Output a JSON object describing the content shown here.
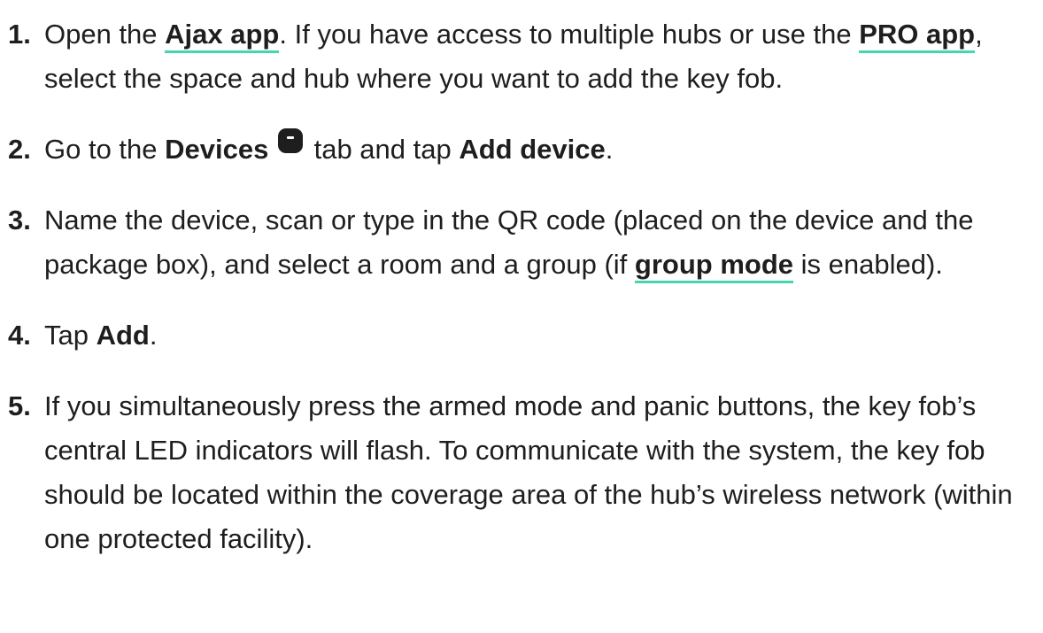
{
  "steps": [
    {
      "number": "1.",
      "t1": "Open the ",
      "link_ajax": "Ajax app",
      "t2": ". If you have access to multiple hubs or use the ",
      "link_pro": "PRO app",
      "t3": ", select the space and hub where you want to add the key fob."
    },
    {
      "number": "2.",
      "t1": "Go to the ",
      "devices_label": "Devices",
      "t2": " tab and tap ",
      "add_device_label": "Add device",
      "t3": "."
    },
    {
      "number": "3.",
      "t1": "Name the device, scan or type in the QR code (placed on the device and the package box), and select a room and a group (if ",
      "link_group_mode": "group mode",
      "t2": " is enabled)."
    },
    {
      "number": "4.",
      "t1": "Tap ",
      "add_label": "Add",
      "t2": "."
    },
    {
      "number": "5.",
      "t1": "If you simultaneously press the armed mode and panic buttons, the key fob’s central LED indicators will flash. To communicate with the system, the key fob should be located within the coverage area of the hub’s wireless network (within one protected facility)."
    }
  ],
  "icons": {
    "devices_tab_icon": "devices-tab-icon"
  },
  "colors": {
    "text": "#1e1e1e",
    "link_underline": "#44d6b2"
  }
}
